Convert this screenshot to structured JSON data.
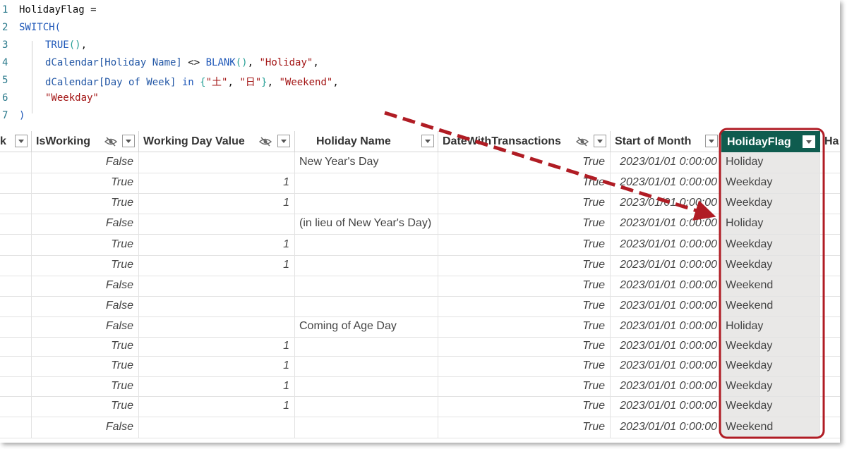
{
  "code": {
    "line_numbers": [
      "1",
      "2",
      "3",
      "4",
      "5",
      "6",
      "7"
    ],
    "l1": "HolidayFlag =",
    "l2_kw": "SWITCH",
    "l2_p": "(",
    "l3_kw": "TRUE",
    "l3_p": "()",
    "l3_c": ",",
    "l4_tbl": "dCalendar",
    "l4_col": "[Holiday Name]",
    "l4_op": " <> ",
    "l4_fn": "BLANK",
    "l4_p": "()",
    "l4_c": ", ",
    "l4_str": "\"Holiday\"",
    "l4_end": ",",
    "l5_tbl": "dCalendar",
    "l5_col": "[Day of Week]",
    "l5_in": " in ",
    "l5_b1": "{",
    "l5_s1": "\"土\"",
    "l5_c1": ", ",
    "l5_s2": "\"日\"",
    "l5_b2": "}",
    "l5_c2": ", ",
    "l5_str": "\"Weekend\"",
    "l5_end": ",",
    "l6_str": "\"Weekday\"",
    "l7_p": ")"
  },
  "table": {
    "headers": {
      "c0": "k",
      "isworking": "IsWorking",
      "working_value": "Working Day Value",
      "holiday_name": "Holiday Name",
      "date_tx": "DateWithTransactions",
      "start_month": "Start of Month",
      "holiday_flag": "HolidayFlag",
      "next": "Ha"
    },
    "rows": [
      {
        "isworking": "False",
        "value": "",
        "holiday": "New Year's Day",
        "tx": "True",
        "start": "2023/01/01 0:00:00",
        "flag": "Holiday"
      },
      {
        "isworking": "True",
        "value": "1",
        "holiday": "",
        "tx": "True",
        "start": "2023/01/01 0:00:00",
        "flag": "Weekday"
      },
      {
        "isworking": "True",
        "value": "1",
        "holiday": "",
        "tx": "True",
        "start": "2023/01/01 0:00:00",
        "flag": "Weekday"
      },
      {
        "isworking": "False",
        "value": "",
        "holiday": "(in lieu of New Year's Day)",
        "tx": "True",
        "start": "2023/01/01 0:00:00",
        "flag": "Holiday"
      },
      {
        "isworking": "True",
        "value": "1",
        "holiday": "",
        "tx": "True",
        "start": "2023/01/01 0:00:00",
        "flag": "Weekday"
      },
      {
        "isworking": "True",
        "value": "1",
        "holiday": "",
        "tx": "True",
        "start": "2023/01/01 0:00:00",
        "flag": "Weekday"
      },
      {
        "isworking": "False",
        "value": "",
        "holiday": "",
        "tx": "True",
        "start": "2023/01/01 0:00:00",
        "flag": "Weekend"
      },
      {
        "isworking": "False",
        "value": "",
        "holiday": "",
        "tx": "True",
        "start": "2023/01/01 0:00:00",
        "flag": "Weekend"
      },
      {
        "isworking": "False",
        "value": "",
        "holiday": "Coming of Age Day",
        "tx": "True",
        "start": "2023/01/01 0:00:00",
        "flag": "Holiday"
      },
      {
        "isworking": "True",
        "value": "1",
        "holiday": "",
        "tx": "True",
        "start": "2023/01/01 0:00:00",
        "flag": "Weekday"
      },
      {
        "isworking": "True",
        "value": "1",
        "holiday": "",
        "tx": "True",
        "start": "2023/01/01 0:00:00",
        "flag": "Weekday"
      },
      {
        "isworking": "True",
        "value": "1",
        "holiday": "",
        "tx": "True",
        "start": "2023/01/01 0:00:00",
        "flag": "Weekday"
      },
      {
        "isworking": "True",
        "value": "1",
        "holiday": "",
        "tx": "True",
        "start": "2023/01/01 0:00:00",
        "flag": "Weekday"
      },
      {
        "isworking": "False",
        "value": "",
        "holiday": "",
        "tx": "True",
        "start": "2023/01/01 0:00:00",
        "flag": "Weekend"
      }
    ]
  },
  "colors": {
    "selected_header": "#0f5c4f",
    "annotation": "#b01c24",
    "flag_column_bg": "#e9e8e7"
  },
  "icons": [
    "hide-icon",
    "filter-dropdown-icon"
  ]
}
